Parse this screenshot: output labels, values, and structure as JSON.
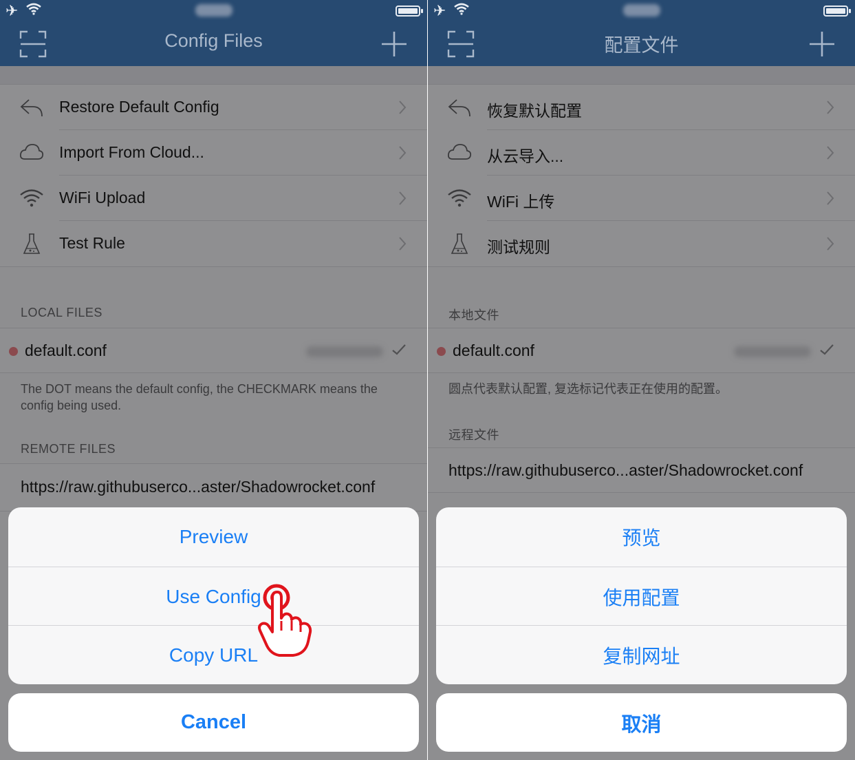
{
  "left": {
    "title": "Config Files",
    "menu": [
      {
        "label": "Restore Default Config",
        "icon": "reply-arrow-icon"
      },
      {
        "label": "Import From Cloud...",
        "icon": "cloud-icon"
      },
      {
        "label": "WiFi Upload",
        "icon": "wifi-icon"
      },
      {
        "label": "Test Rule",
        "icon": "flask-icon"
      }
    ],
    "local_header": "LOCAL FILES",
    "local_file": "default.conf",
    "note": "The DOT means the default config, the CHECKMARK means the config being used.",
    "remote_header": "REMOTE FILES",
    "remote_url": "https://raw.githubuserco...aster/Shadowrocket.conf",
    "sheet": [
      "Preview",
      "Use Config",
      "Copy URL"
    ],
    "cancel": "Cancel"
  },
  "right": {
    "title": "配置文件",
    "menu": [
      {
        "label": "恢复默认配置",
        "icon": "reply-arrow-icon"
      },
      {
        "label": "从云导入...",
        "icon": "cloud-icon"
      },
      {
        "label": "WiFi 上传",
        "icon": "wifi-icon"
      },
      {
        "label": "测试规则",
        "icon": "flask-icon"
      }
    ],
    "local_header": "本地文件",
    "local_file": "default.conf",
    "note": "圆点代表默认配置, 复选标记代表正在使用的配置。",
    "remote_header": "远程文件",
    "remote_url": "https://raw.githubuserco...aster/Shadowrocket.conf",
    "sheet": [
      "预览",
      "使用配置",
      "复制网址"
    ],
    "cancel": "取消"
  },
  "status_bar": {
    "airplane_icon": "✈"
  },
  "colors": {
    "nav_bar": "#274a71",
    "dimmed_background": "#8e8e90",
    "action_tint": "#1a7ff5",
    "default_dot": "#8b4a4e",
    "pointer_hand": "#e0141c"
  }
}
